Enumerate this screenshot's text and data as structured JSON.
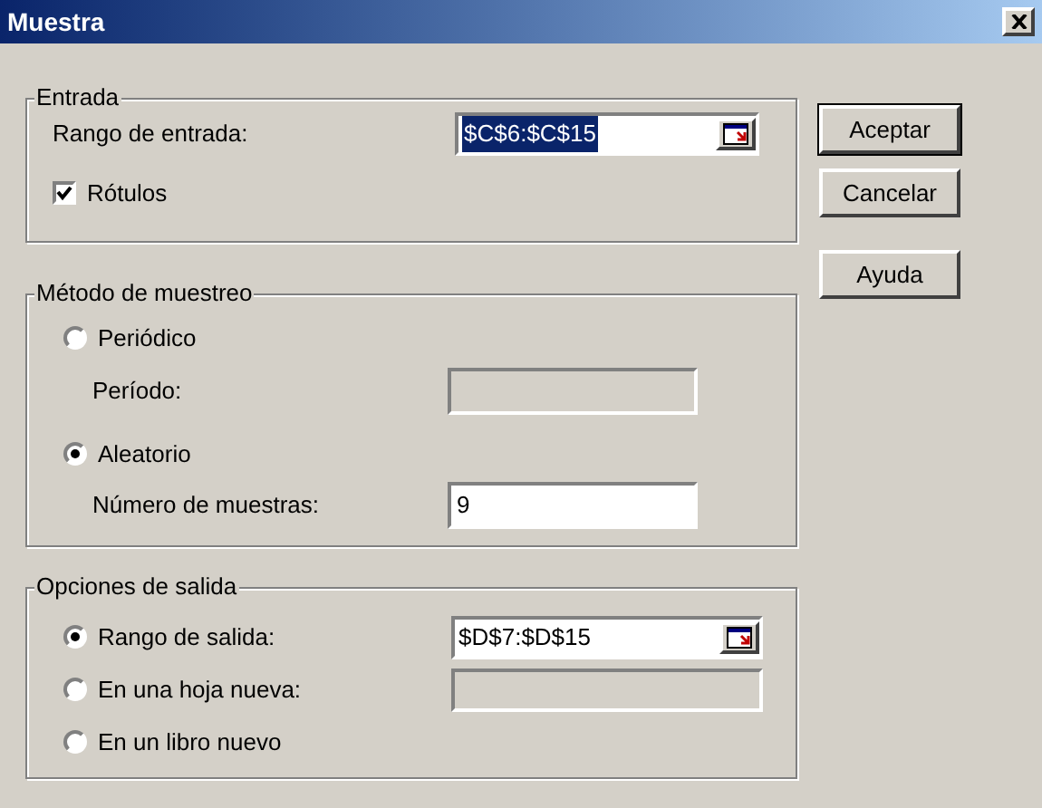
{
  "window": {
    "title": "Muestra"
  },
  "input_group": {
    "legend": "Entrada",
    "range_label": "Rango de entrada:",
    "range_value": "$C$6:$C$15",
    "range_selected": true,
    "labels_checkbox": {
      "label": "Rótulos",
      "checked": true
    }
  },
  "method_group": {
    "legend": "Método de muestreo",
    "options": [
      {
        "label": "Periódico",
        "selected": false,
        "field_label": "Período:",
        "field_disabled": true
      },
      {
        "label": "Aleatorio",
        "selected": true,
        "field_label": "Número de muestras:",
        "field_value": "9",
        "field_disabled": false
      }
    ]
  },
  "output_group": {
    "legend": "Opciones de salida",
    "options": [
      {
        "label": "Rango de salida:",
        "selected": true,
        "kind": "range",
        "field_value": "$D$7:$D$15",
        "field_disabled": false
      },
      {
        "label": "En una hoja nueva:",
        "selected": false,
        "kind": "field",
        "field_disabled": true
      },
      {
        "label": "En un libro nuevo",
        "selected": false,
        "kind": "none"
      }
    ]
  },
  "buttons": [
    "Aceptar",
    "Cancelar",
    "Ayuda"
  ]
}
